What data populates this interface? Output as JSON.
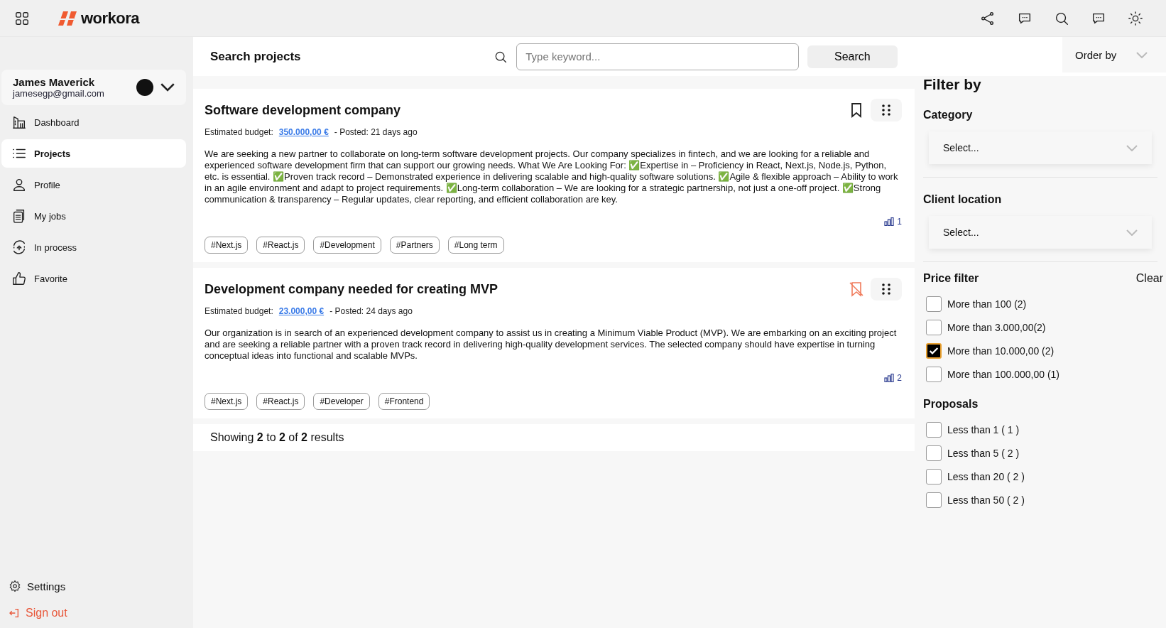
{
  "header": {
    "logo": "workora"
  },
  "user": {
    "name": "James Maverick",
    "email": "jamesegp@gmail.com"
  },
  "sidebar": {
    "items": [
      {
        "label": "Dashboard",
        "selected": false
      },
      {
        "label": "Projects",
        "selected": true
      },
      {
        "label": "Profile",
        "selected": false
      },
      {
        "label": "My jobs",
        "selected": false
      },
      {
        "label": "In process",
        "selected": false
      },
      {
        "label": "Favorite",
        "selected": false
      }
    ],
    "settings": "Settings",
    "sign_out": "Sign out"
  },
  "search": {
    "title": "Search projects",
    "placeholder": "Type keyword...",
    "button": "Search",
    "order_by": "Order by"
  },
  "projects": [
    {
      "title": "Software development company",
      "budget_label": "Estimated budget:",
      "budget": "350.000,00 €",
      "posted": "- Posted: 21 days ago",
      "description": "We are seeking a new partner to collaborate on long-term software development projects. Our company specializes in fintech, and we are looking for a reliable and experienced software development firm that can support our growing needs. What We Are Looking For: ✅Expertise in – Proficiency in React, Next.js, Node.js, Python, etc. is essential. ✅Proven track record – Demonstrated experience in delivering scalable and high-quality software solutions. ✅Agile & flexible approach – Ability to work in an agile environment and adapt to project requirements. ✅Long-term collaboration – We are looking for a strategic partnership, not just a one-off project. ✅Strong communication & transparency – Regular updates, clear reporting, and efficient collaboration are key.",
      "saved": false,
      "proposals": "1",
      "tags": [
        "#Next.js",
        "#React.js",
        "#Development",
        "#Partners",
        "#Long term"
      ]
    },
    {
      "title": "Development company needed for creating MVP",
      "budget_label": "Estimated budget:",
      "budget": "23.000,00 €",
      "posted": "- Posted: 24 days ago",
      "description": "Our organization is in search of an experienced development company to assist us in creating a Minimum Viable Product (MVP). We are embarking on an exciting project and are seeking a reliable partner with a proven track record in delivering high-quality development services. The selected company should have expertise in turning conceptual ideas into functional and scalable MVPs.",
      "saved": true,
      "proposals": "2",
      "tags": [
        "#Next.js",
        "#React.js",
        "#Developer",
        "#Frontend"
      ]
    }
  ],
  "results": "Showing **2** to **2** of **2** results",
  "filters": {
    "title": "Filter by",
    "category": {
      "label": "Category",
      "placeholder": "Select..."
    },
    "location": {
      "label": "Client location",
      "placeholder": "Select..."
    },
    "price": {
      "label": "Price filter",
      "clear": "Clear",
      "options": [
        {
          "label": "More than 100 (2)",
          "checked": false
        },
        {
          "label": "More than 3.000,00(2)",
          "checked": false
        },
        {
          "label": "More than 10.000,00 (2)",
          "checked": true
        },
        {
          "label": "More than 100.000,00 (1)",
          "checked": false
        }
      ]
    },
    "proposals": {
      "label": "Proposals",
      "options": [
        {
          "label": "Less than 1 ( 1 )",
          "checked": false
        },
        {
          "label": "Less than 5 ( 2 )",
          "checked": false
        },
        {
          "label": "Less than 20 ( 2 )",
          "checked": false
        },
        {
          "label": "Less than 50 ( 2 )",
          "checked": false
        }
      ]
    }
  }
}
